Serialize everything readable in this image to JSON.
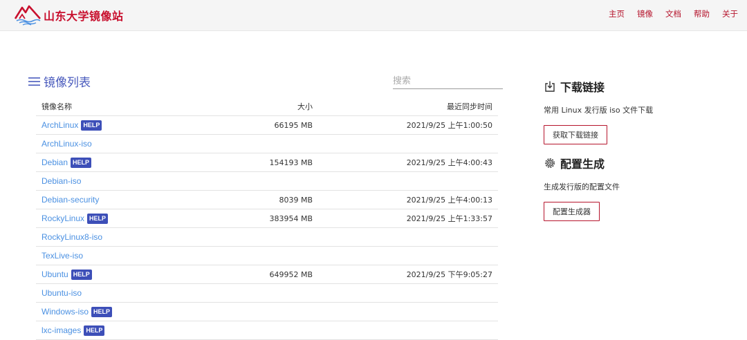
{
  "header": {
    "logo_text": "山东大学镜像站",
    "nav": [
      "主页",
      "镜像",
      "文档",
      "帮助",
      "关于"
    ]
  },
  "list": {
    "title": "镜像列表",
    "search_placeholder": "搜索",
    "columns": {
      "name": "镜像名称",
      "size": "大小",
      "time": "最近同步时间"
    },
    "help_label": "HELP",
    "rows": [
      {
        "name": "ArchLinux",
        "help": true,
        "size": "66195 MB",
        "time": "2021/9/25 上午1:00:50"
      },
      {
        "name": "ArchLinux-iso",
        "help": false,
        "size": "",
        "time": ""
      },
      {
        "name": "Debian",
        "help": true,
        "size": "154193 MB",
        "time": "2021/9/25 上午4:00:43"
      },
      {
        "name": "Debian-iso",
        "help": false,
        "size": "",
        "time": ""
      },
      {
        "name": "Debian-security",
        "help": false,
        "size": "8039 MB",
        "time": "2021/9/25 上午4:00:13"
      },
      {
        "name": "RockyLinux",
        "help": true,
        "size": "383954 MB",
        "time": "2021/9/25 上午1:33:57"
      },
      {
        "name": "RockyLinux8-iso",
        "help": false,
        "size": "",
        "time": ""
      },
      {
        "name": "TexLive-iso",
        "help": false,
        "size": "",
        "time": ""
      },
      {
        "name": "Ubuntu",
        "help": true,
        "size": "649952 MB",
        "time": "2021/9/25 下午9:05:27"
      },
      {
        "name": "Ubuntu-iso",
        "help": false,
        "size": "",
        "time": ""
      },
      {
        "name": "Windows-iso",
        "help": true,
        "size": "",
        "time": ""
      },
      {
        "name": "lxc-images",
        "help": true,
        "size": "",
        "time": ""
      }
    ]
  },
  "download": {
    "title": "下载链接",
    "desc": "常用 Linux 发行版 iso 文件下载",
    "button": "获取下载链接"
  },
  "config": {
    "title": "配置生成",
    "desc": "生成发行版的配置文件",
    "button": "配置生成器"
  },
  "colors": {
    "brand": "#c8102e",
    "accent": "#4a5bbd",
    "link": "#4a90e2",
    "help_badge": "#3d4fb8"
  }
}
